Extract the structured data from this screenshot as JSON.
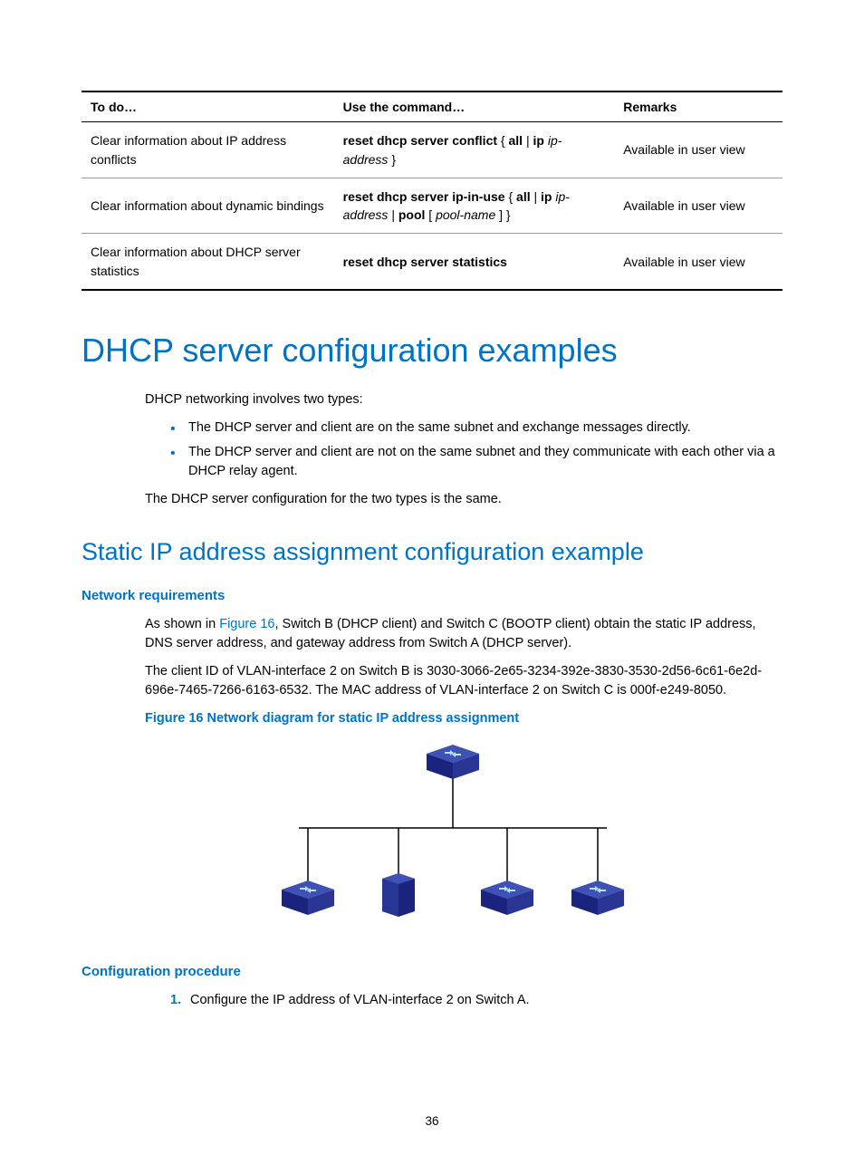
{
  "table": {
    "headers": [
      "To do…",
      "Use the command…",
      "Remarks"
    ],
    "rows": [
      {
        "todo": "Clear information about IP address conflicts",
        "cmd_parts": [
          {
            "t": "reset dhcp server conflict",
            "b": true
          },
          {
            "t": " { ",
            "b": false
          },
          {
            "t": "all",
            "b": true
          },
          {
            "t": " | ",
            "b": false
          },
          {
            "t": "ip",
            "b": true
          },
          {
            "t": " ",
            "b": false
          },
          {
            "t": "ip-address",
            "i": true
          },
          {
            "t": " }",
            "b": false
          }
        ],
        "remarks": "Available in user view"
      },
      {
        "todo": "Clear information about dynamic bindings",
        "cmd_parts": [
          {
            "t": "reset dhcp server ip-in-use",
            "b": true
          },
          {
            "t": " { ",
            "b": false
          },
          {
            "t": "all",
            "b": true
          },
          {
            "t": " | ",
            "b": false
          },
          {
            "t": "ip",
            "b": true
          },
          {
            "t": " ",
            "b": false
          },
          {
            "t": "ip-address",
            "i": true
          },
          {
            "t": " | ",
            "b": false
          },
          {
            "t": "pool",
            "b": true
          },
          {
            "t": " [ ",
            "b": false
          },
          {
            "t": "pool-name",
            "i": true
          },
          {
            "t": " ] }",
            "b": false
          }
        ],
        "remarks": "Available in user view"
      },
      {
        "todo": "Clear information about DHCP server statistics",
        "cmd_parts": [
          {
            "t": "reset dhcp server statistics",
            "b": true
          }
        ],
        "remarks": "Available in user view"
      }
    ]
  },
  "h1": "DHCP server configuration examples",
  "intro": {
    "p1": "DHCP networking involves two types:",
    "bullets": [
      "The DHCP server and client are on the same subnet and exchange messages directly.",
      "The DHCP server and client are not on the same subnet and they communicate with each other via a DHCP relay agent."
    ],
    "p2": "The DHCP server configuration for the two types is the same."
  },
  "h2": "Static IP address assignment configuration example",
  "netreq": {
    "title": "Network requirements",
    "p1a": "As shown in ",
    "p1link": "Figure 16",
    "p1b": ", Switch B (DHCP client) and Switch C (BOOTP client) obtain the static IP address, DNS server address, and gateway address from Switch A (DHCP server).",
    "p2": "The client ID of VLAN-interface 2 on Switch B is 3030-3066-2e65-3234-392e-3830-3530-2d56-6c61-6e2d-696e-7465-7266-6163-6532. The MAC address of VLAN-interface 2 on Switch C is 000f-e249-8050.",
    "fig_caption": "Figure 16 Network diagram for static IP address assignment"
  },
  "confproc": {
    "title": "Configuration procedure",
    "steps": [
      "Configure the IP address of VLAN-interface 2 on Switch A."
    ]
  },
  "page_number": "36"
}
